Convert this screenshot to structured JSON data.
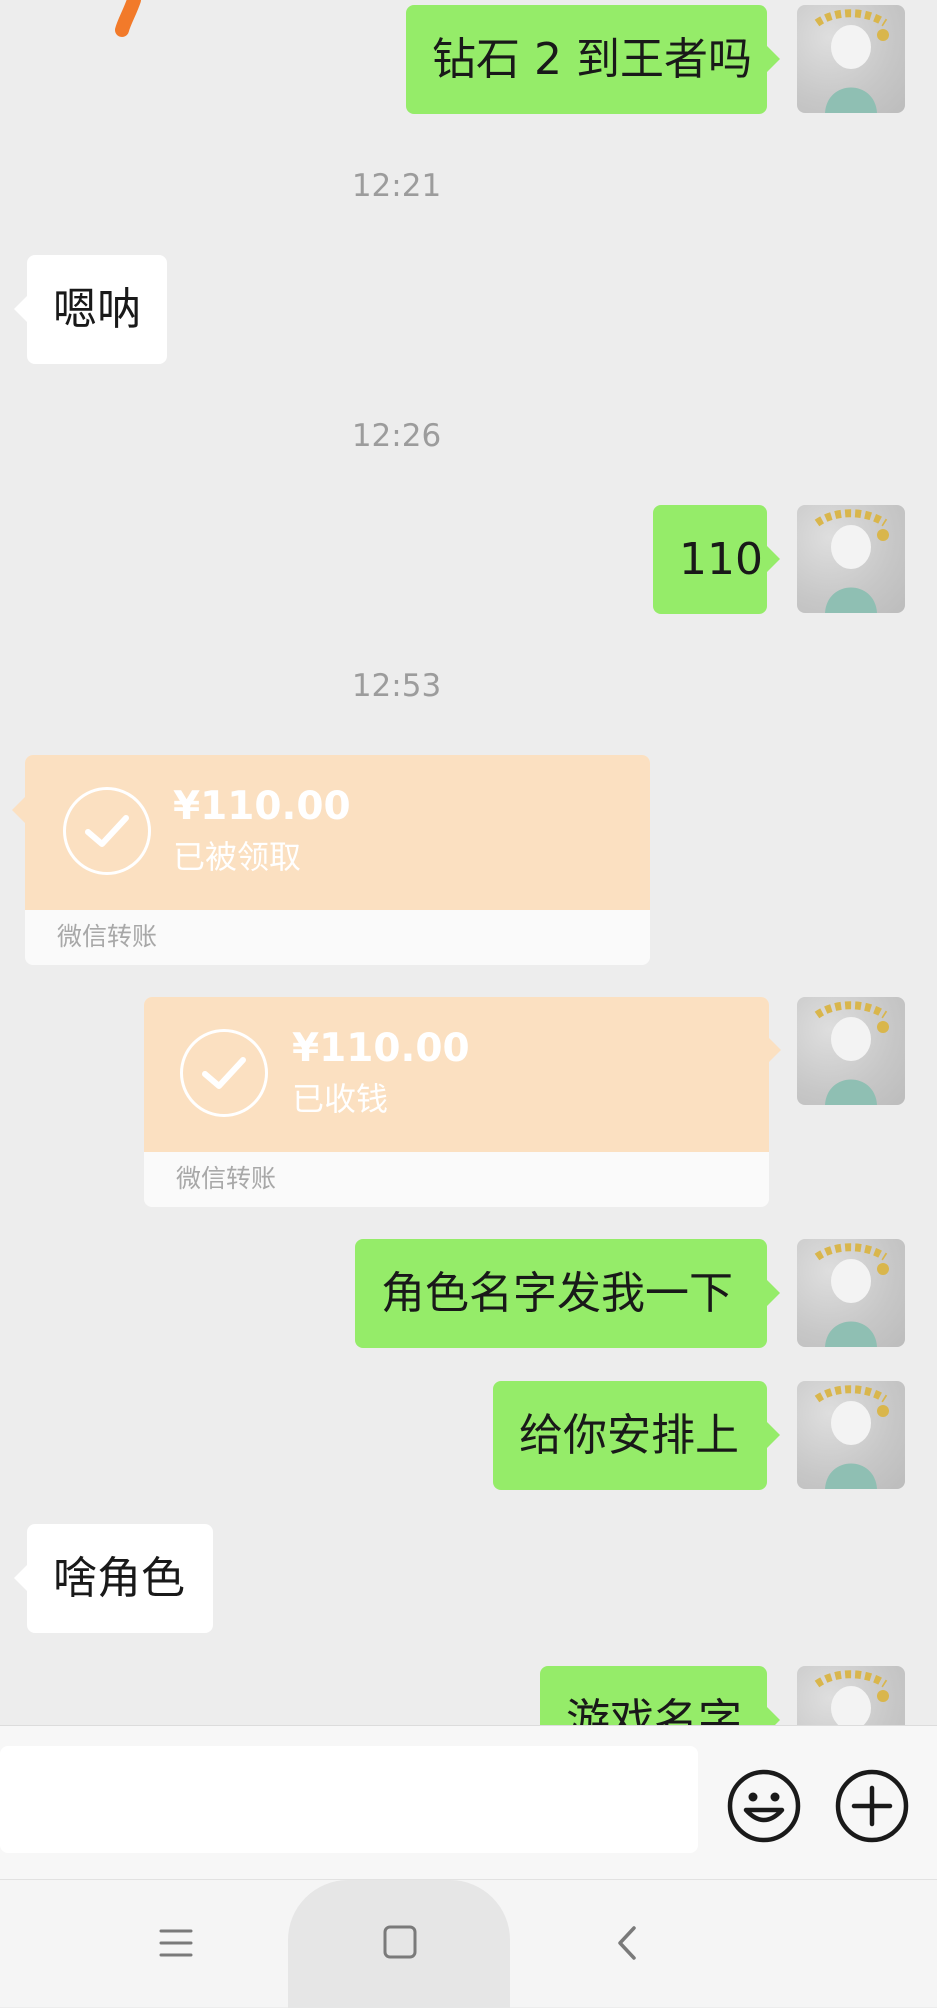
{
  "colors": {
    "background": "#ededed",
    "my_bubble": "#95ec69",
    "other_bubble": "#ffffff",
    "transfer_accent": "#fbe0c1",
    "timestamp": "#9c9c9c"
  },
  "messages": {
    "m1_text": "钻石 2 到王者吗",
    "t1": "12:21",
    "m2_text": "嗯呐",
    "t2": "12:26",
    "m3_text": "110",
    "t3": "12:53",
    "transfer1": {
      "amount": "¥110.00",
      "status": "已被领取",
      "label": "微信转账"
    },
    "transfer2": {
      "amount": "¥110.00",
      "status": "已收钱",
      "label": "微信转账"
    },
    "m4_text": "角色名字发我一下",
    "m5_text": "给你安排上",
    "m6_text": "啥角色",
    "m7_text": "游戏名字"
  },
  "input_bar": {
    "placeholder": "",
    "emoji_icon": "emoji-icon",
    "plus_icon": "plus-icon"
  },
  "nav_bar": {
    "menu_icon": "menu-icon",
    "home_icon": "home-icon",
    "back_icon": "back-icon"
  }
}
